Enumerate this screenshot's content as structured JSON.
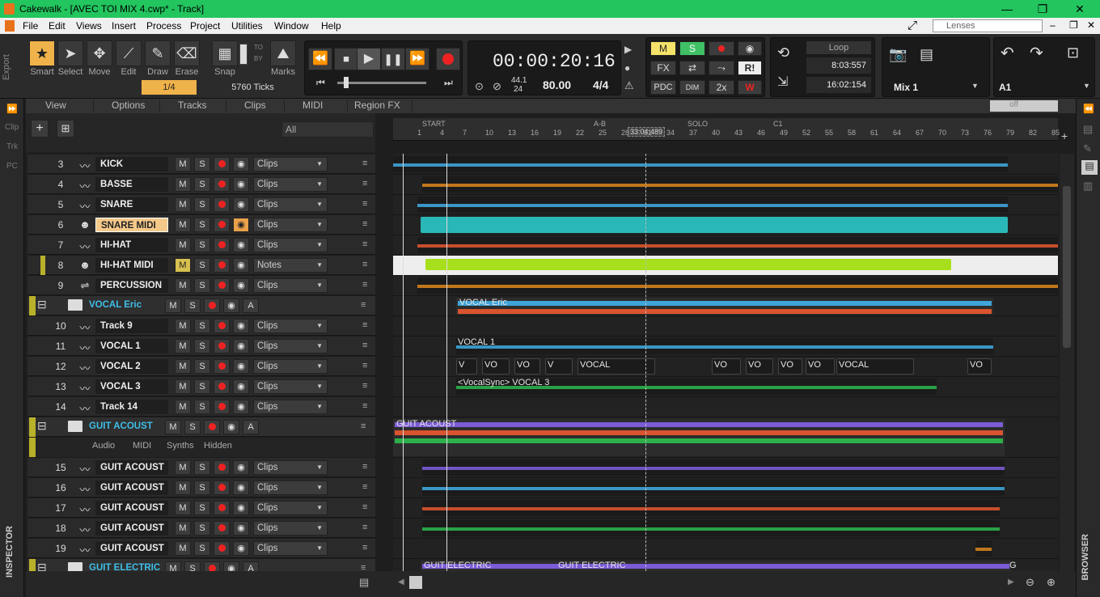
{
  "window": {
    "title": "Cakewalk - [AVEC TOI MIX 4.cwp* - Track]"
  },
  "menu": [
    "File",
    "Edit",
    "Views",
    "Insert",
    "Process",
    "Project",
    "Utilities",
    "Window",
    "Help"
  ],
  "lenses": "Lenses",
  "tools": {
    "smart": "Smart",
    "select": "Select",
    "move": "Move",
    "edit": "Edit",
    "draw": "Draw",
    "erase": "Erase",
    "snap": "Snap",
    "to": "TO",
    "by": "BY",
    "marks": "Marks",
    "fraction": "1/4",
    "ticks": "5760 Ticks"
  },
  "transport": {
    "time": "00:00:20:16",
    "sr": "44.1",
    "bits": "24",
    "tempo": "80.00",
    "meter": "4/4"
  },
  "mixbtns": {
    "m": "M",
    "s": "S",
    "fx": "FX",
    "r": "R!",
    "pdc": "PDC",
    "dim": "DIM",
    "x2": "2x"
  },
  "loop": {
    "label": "Loop",
    "start": "8:03:557",
    "end": "16:02:154"
  },
  "mix": {
    "name": "Mix 1",
    "a": "A1",
    "off": "off"
  },
  "views": {
    "view": "View",
    "options": "Options",
    "tracks": "Tracks",
    "clips": "Clips",
    "midi": "MIDI",
    "regionfx": "Region FX",
    "filter": "All"
  },
  "side": {
    "export": "Export",
    "clip": "Clip",
    "trk": "Trk",
    "pc": "PC",
    "inspector": "INSPECTOR",
    "browser": "BROWSER"
  },
  "ruler": {
    "markers": [
      "START",
      "A-B",
      "SOLO",
      "C1"
    ],
    "pos": "33:04:489",
    "bars": [
      "1",
      "4",
      "7",
      "10",
      "13",
      "16",
      "19",
      "22",
      "25",
      "28",
      "31",
      "34",
      "37",
      "40",
      "43",
      "46",
      "49",
      "52",
      "55",
      "58",
      "61",
      "64",
      "67",
      "70",
      "73",
      "76",
      "79",
      "82",
      "85"
    ]
  },
  "tracks": [
    {
      "num": "3",
      "name": "KICK",
      "mode": "Clips"
    },
    {
      "num": "4",
      "name": "BASSE",
      "mode": "Clips"
    },
    {
      "num": "5",
      "name": "SNARE",
      "mode": "Clips"
    },
    {
      "num": "6",
      "name": "SNARE MIDI",
      "mode": "Clips"
    },
    {
      "num": "7",
      "name": "HI-HAT",
      "mode": "Clips"
    },
    {
      "num": "8",
      "name": "HI-HAT MIDI",
      "mode": "Notes"
    },
    {
      "num": "9",
      "name": "PERCUSSION",
      "mode": "Clips"
    },
    {
      "folder": "VOCAL Eric"
    },
    {
      "num": "10",
      "name": "Track 9",
      "mode": "Clips"
    },
    {
      "num": "11",
      "name": "VOCAL 1",
      "mode": "Clips"
    },
    {
      "num": "12",
      "name": "VOCAL 2",
      "mode": "Clips"
    },
    {
      "num": "13",
      "name": "VOCAL 3",
      "mode": "Clips"
    },
    {
      "num": "14",
      "name": "Track 14",
      "mode": "Clips"
    },
    {
      "folder": "GUIT ACOUST"
    },
    {
      "num": "15",
      "name": "GUIT ACOUST",
      "mode": "Clips"
    },
    {
      "num": "16",
      "name": "GUIT ACOUST",
      "mode": "Clips"
    },
    {
      "num": "17",
      "name": "GUIT ACOUST",
      "mode": "Clips"
    },
    {
      "num": "18",
      "name": "GUIT ACOUST",
      "mode": "Clips"
    },
    {
      "num": "19",
      "name": "GUIT ACOUST",
      "mode": "Clips"
    },
    {
      "folder": "GUIT ELECTRIC"
    }
  ],
  "folderTabs": [
    "Audio",
    "MIDI",
    "Synths",
    "Hidden"
  ],
  "letters": {
    "m": "M",
    "s": "S",
    "a": "A"
  },
  "clips": {
    "vocalEric": "VOCAL Eric",
    "vocal1": "VOCAL 1",
    "vocal2": [
      "V",
      "VO",
      "VO",
      "V",
      "VOCAL",
      "VO",
      "VO",
      "VO",
      "VO",
      "VOCAL",
      "VO"
    ],
    "vocal3": "<VocalSync> VOCAL 3",
    "guitAcoust": "GUIT ACOUST",
    "guitElec1": "GUIT ELECTRIC",
    "guitElec2": "GUIT ELECTRIC",
    "g": "G"
  },
  "colors": {
    "titlebar": "#22c55e",
    "blue": "#3fa4d8",
    "orange": "#d4821e",
    "red": "#d9542f",
    "teal": "#2ab7b7",
    "lime": "#a7df1d",
    "green": "#2db04b",
    "purple": "#7b5bd6"
  }
}
